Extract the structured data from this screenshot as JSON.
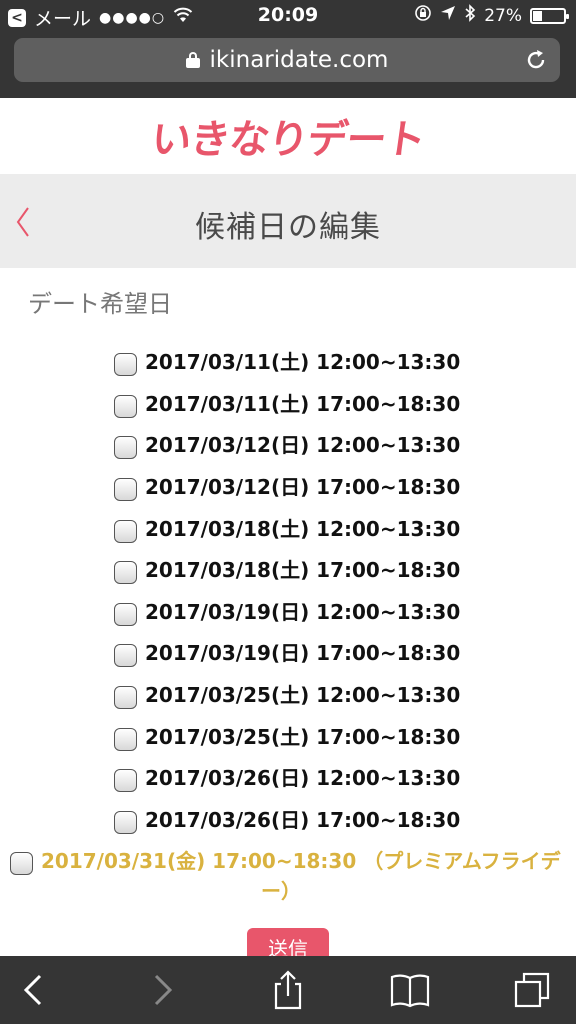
{
  "status_bar": {
    "back_app": "メール",
    "signal": "●●●●○",
    "time": "20:09",
    "battery_percent": "27%",
    "battery_level": 0.27
  },
  "browser": {
    "url": "ikinaridate.com"
  },
  "site": {
    "logo_text": "いきなりデート",
    "brand_color": "#e8566b",
    "accent_color": "#d9b23f"
  },
  "header": {
    "title": "候補日の編集"
  },
  "section": {
    "label": "デート希望日"
  },
  "dates": [
    "2017/03/11(土) 12:00~13:30",
    "2017/03/11(土) 17:00~18:30",
    "2017/03/12(日) 12:00~13:30",
    "2017/03/12(日) 17:00~18:30",
    "2017/03/18(土) 12:00~13:30",
    "2017/03/18(土) 17:00~18:30",
    "2017/03/19(日) 12:00~13:30",
    "2017/03/19(日) 17:00~18:30",
    "2017/03/25(土) 12:00~13:30",
    "2017/03/25(土) 17:00~18:30",
    "2017/03/26(日) 12:00~13:30",
    "2017/03/26(日) 17:00~18:30"
  ],
  "special_date": {
    "line1": "2017/03/31(金) 17:00~18:30 （プレミアムフライデ",
    "line2": "ー）"
  },
  "submit": {
    "label": "送信"
  },
  "toolbar": {
    "icons": [
      "back-icon",
      "forward-icon",
      "share-icon",
      "bookmarks-icon",
      "tabs-icon"
    ]
  }
}
